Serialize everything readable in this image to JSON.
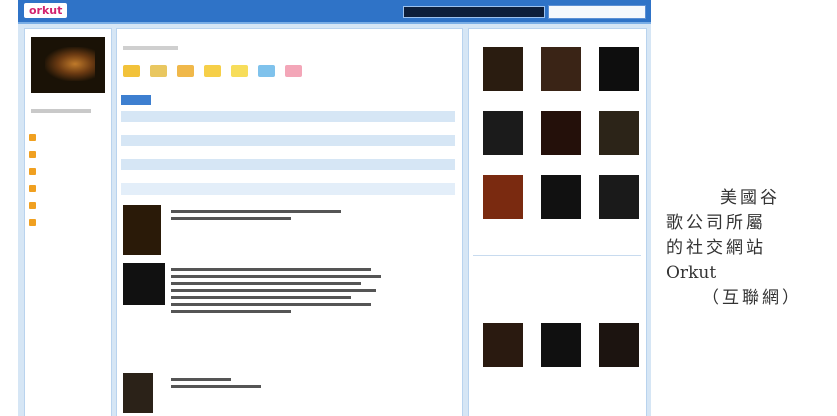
{
  "app": {
    "logo": "orkut",
    "nav_text": "",
    "accent": "#2f73c7",
    "brand": "#d2236f"
  },
  "left": {
    "profile_name": "",
    "nav": [
      {
        "label": ""
      },
      {
        "label": ""
      },
      {
        "label": ""
      },
      {
        "label": ""
      },
      {
        "label": ""
      },
      {
        "label": ""
      }
    ]
  },
  "main": {
    "title": "",
    "button_label": "",
    "info": [
      {
        "key": "",
        "value": ""
      },
      {
        "key": "",
        "value": ""
      },
      {
        "key": "",
        "value": ""
      },
      {
        "key": "",
        "value": ""
      },
      {
        "key": "",
        "value": ""
      }
    ],
    "section_title": "",
    "scraps": [
      {
        "name": ""
      },
      {
        "name": ""
      },
      {
        "name": ""
      }
    ]
  },
  "right": {
    "friends_head": "",
    "friends": [
      "",
      "",
      "",
      "",
      "",
      "",
      "",
      "",
      ""
    ],
    "communities_head": "",
    "communities": [
      "",
      "",
      ""
    ]
  },
  "caption": {
    "line1": "美國谷",
    "line2": "歌公司所屬",
    "line3": "的社交網站",
    "line4": "Orkut",
    "line5": "（互聯網）"
  }
}
